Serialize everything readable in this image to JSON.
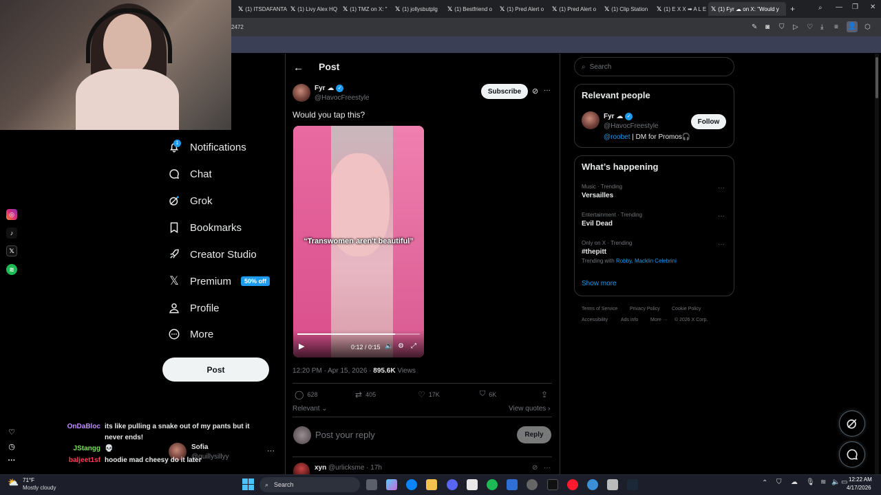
{
  "browser": {
    "tabs": [
      {
        "label": "(1) ITSDAFANTA"
      },
      {
        "label": "(1) Livy Alex HQ"
      },
      {
        "label": "(1) TMZ on X: \""
      },
      {
        "label": "(1) jollysbutplg"
      },
      {
        "label": "(1) Bestfriend o"
      },
      {
        "label": "(1) Pred Alert o"
      },
      {
        "label": "(1) Pred Alert o"
      },
      {
        "label": "(1) Clip Station"
      },
      {
        "label": "(1) E X X ➡ A L E"
      },
      {
        "label": "(1) Fyr ☁ on X: \"Would y"
      }
    ],
    "url_fragment": "2472"
  },
  "nav": {
    "notifications": "Notifications",
    "notifications_badge": "1",
    "chat": "Chat",
    "grok": "Grok",
    "bookmarks": "Bookmarks",
    "creator_studio": "Creator Studio",
    "premium": "Premium",
    "premium_badge": "50% off",
    "profile": "Profile",
    "more": "More",
    "post_button": "Post"
  },
  "chat_overlay": [
    {
      "user": "OnDaBloc",
      "color": "#c08cff",
      "text": "its like pulling a snake out of my pants but it"
    },
    {
      "user": "",
      "color": "#c08cff",
      "text": "never ends!"
    },
    {
      "user": "JStangg",
      "color": "#78e05a",
      "text": "💀"
    },
    {
      "user": "baljeet1sf",
      "color": "#ff3f56",
      "text": "hoodie mad cheesy do it later"
    }
  ],
  "account_switcher": {
    "name": "Sofia",
    "handle": "@quillysillyy"
  },
  "post": {
    "header": "Post",
    "author_name": "Fyr ☁",
    "author_handle": "@HavocFreestyle",
    "subscribe": "Subscribe",
    "text": "Would you tap this?",
    "video_caption": "“Transwomen aren't beautiful”",
    "video_time": "0:12 / 0:15",
    "video_progress": 0.8,
    "timestamp": "12:20 PM · Apr 15, 2026 ·",
    "views_count": "895.6K",
    "views_label": "Views",
    "replies": "628",
    "reposts": "405",
    "likes": "17K",
    "bookmarks": "6K",
    "sort_label": "Relevant",
    "view_quotes": "View quotes",
    "reply_placeholder": "Post your reply",
    "reply_button": "Reply",
    "next_reply_name": "xyn",
    "next_reply_handle": "@urlicksme · 17h"
  },
  "right": {
    "search_placeholder": "Search",
    "relevant_title": "Relevant people",
    "person_name": "Fyr ☁",
    "person_handle": "@HavocFreestyle",
    "person_bio_link": "@roobet",
    "person_bio_rest": " | DM for Promos🎧",
    "follow": "Follow",
    "happening_title": "What’s happening",
    "trends": [
      {
        "meta": "Music · Trending",
        "name": "Versailles"
      },
      {
        "meta": "Entertainment · Trending",
        "name": "Evil Dead"
      },
      {
        "meta": "Only on X · Trending",
        "name": "#thepitt",
        "with_label": "Trending with",
        "with_links": "Robby, Macklin Celebrini"
      }
    ],
    "show_more": "Show more",
    "footer": [
      "Terms of Service",
      "Privacy Policy",
      "Cookie Policy",
      "Accessibility",
      "Ads info",
      "More ···",
      "© 2026 X Corp."
    ]
  },
  "taskbar": {
    "weather_temp": "71°F",
    "weather_desc": "Mostly cloudy",
    "search": "Search",
    "time": "12:22 AM",
    "date": "4/17/2026"
  }
}
